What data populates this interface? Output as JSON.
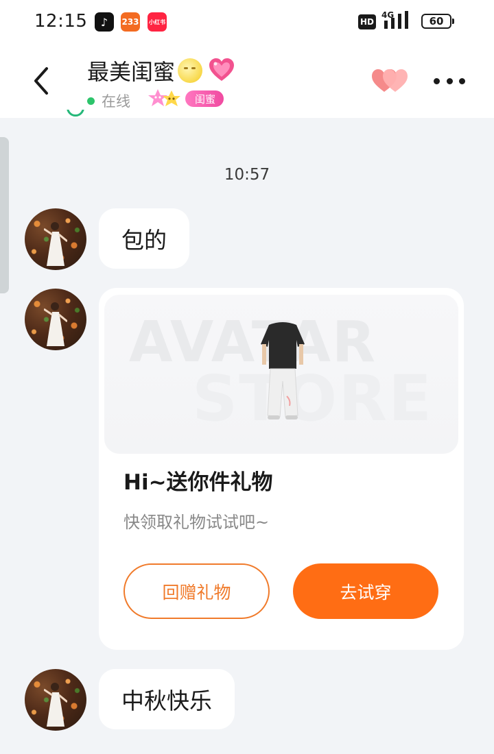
{
  "status_bar": {
    "time": "12:15",
    "apps": [
      {
        "name": "tiktok-icon",
        "glyph": "♪"
      },
      {
        "name": "app-233-icon",
        "glyph": "233"
      },
      {
        "name": "xiaohongshu-icon",
        "glyph": "小红书"
      }
    ],
    "hd": "HD",
    "network": "4G",
    "battery": "60"
  },
  "header": {
    "title": "最美闺蜜",
    "status": "在线",
    "relation_badge": "闺蜜",
    "icons": [
      "back-arrow-icon",
      "moon-emoji-icon",
      "pink-heart-emoji-icon",
      "twin-hearts-icon",
      "more-icon"
    ]
  },
  "chat": {
    "timestamp": "10:57",
    "messages": [
      {
        "type": "text",
        "text": "包的"
      },
      {
        "type": "gift_card",
        "banner_watermark": [
          "AVATAR",
          "STORE"
        ],
        "title": "Hi~送你件礼物",
        "subtitle": "快领取礼物试试吧~",
        "secondary_button": "回赠礼物",
        "primary_button": "去试穿"
      },
      {
        "type": "text",
        "text": "中秋快乐"
      }
    ]
  },
  "colors": {
    "accent": "#ff6d14",
    "online": "#2dc46b",
    "badge": "#f04aa0",
    "background": "#f2f4f7"
  }
}
